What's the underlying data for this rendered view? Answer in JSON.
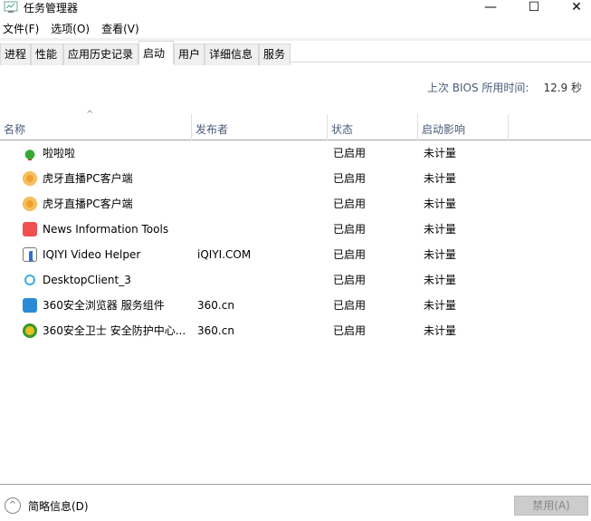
{
  "window": {
    "title": "任务管理器",
    "minimize": "—",
    "maximize": "☐",
    "close": "✕"
  },
  "menu": [
    "文件(F)",
    "选项(O)",
    "查看(V)"
  ],
  "tabs": [
    "进程",
    "性能",
    "应用历史记录",
    "启动",
    "用户",
    "详细信息",
    "服务"
  ],
  "active_tab": "启动",
  "bios": {
    "label": "上次 BIOS 所用时间:",
    "value": "12.9 秒"
  },
  "columns": [
    "名称",
    "发布者",
    "状态",
    "启动影响"
  ],
  "rows": [
    {
      "name": "啦啦啦",
      "publisher": "",
      "status": "已启用",
      "impact": "未计量",
      "icon": "tree-icon"
    },
    {
      "name": "虎牙直播PC客户端",
      "publisher": "",
      "status": "已启用",
      "impact": "未计量",
      "icon": "huya-icon"
    },
    {
      "name": "虎牙直播PC客户端",
      "publisher": "",
      "status": "已启用",
      "impact": "未计量",
      "icon": "huya-icon"
    },
    {
      "name": "News Information Tools",
      "publisher": "",
      "status": "已启用",
      "impact": "未计量",
      "icon": "news-icon"
    },
    {
      "name": "IQIYI Video Helper",
      "publisher": "iQIYI.COM",
      "status": "已启用",
      "impact": "未计量",
      "icon": "window-icon"
    },
    {
      "name": "DesktopClient_3",
      "publisher": "",
      "status": "已启用",
      "impact": "未计量",
      "icon": "search-icon"
    },
    {
      "name": "360安全浏览器 服务组件",
      "publisher": "360.cn",
      "status": "已启用",
      "impact": "未计量",
      "icon": "browser-360-icon"
    },
    {
      "name": "360安全卫士 安全防护中心...",
      "publisher": "360.cn",
      "status": "已启用",
      "impact": "未计量",
      "icon": "guard-360-icon"
    }
  ],
  "footer": {
    "brief": "简略信息(D)",
    "disable": "禁用(A)"
  }
}
